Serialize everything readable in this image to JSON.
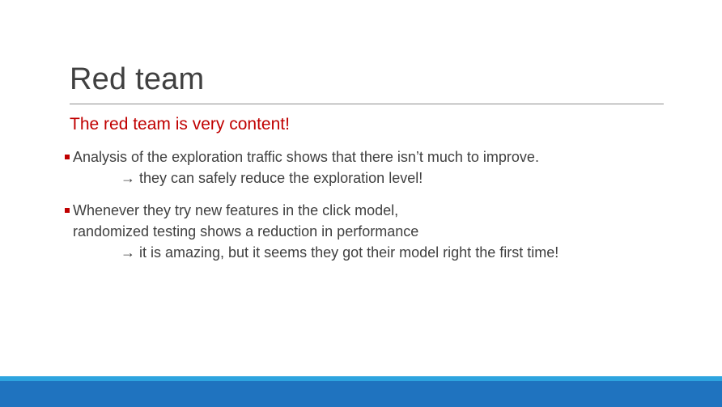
{
  "slide": {
    "title": "Red team",
    "subtitle": "The red team is very content!",
    "bullets": [
      {
        "lines": [
          "Analysis of the exploration traffic shows that there isn’t much to improve.",
          "→ they can safely reduce the exploration level!"
        ]
      },
      {
        "lines": [
          "Whenever they try new features in the click model,",
          "randomized testing shows a reduction in performance",
          "→ it is amazing, but it seems they got their model right the first time!"
        ]
      }
    ]
  },
  "colors": {
    "accent_red": "#c00000",
    "band_dark_blue": "#1f73bf",
    "band_light_blue": "#2da4df",
    "text": "#404040"
  }
}
